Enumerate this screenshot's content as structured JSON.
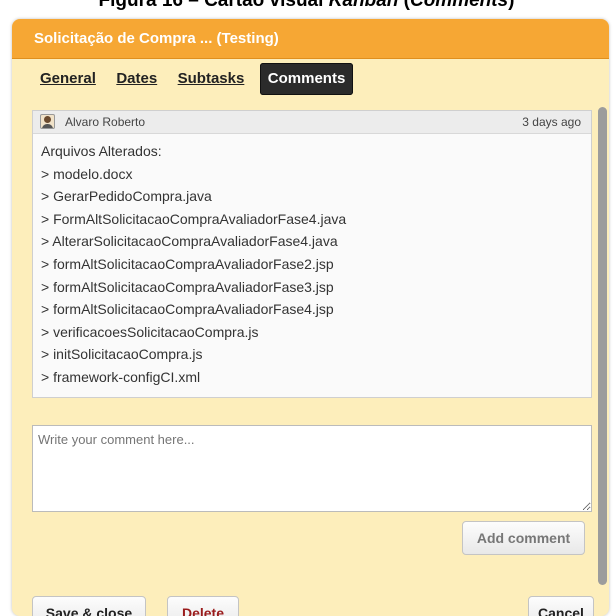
{
  "caption": {
    "prefix": "Figura 16 – Cartão visual ",
    "italic": "Kanban",
    "suffix_open": " (",
    "suffix_italic": "Comments",
    "suffix_close": ")"
  },
  "card": {
    "title": "Solicitação de Compra ... (Testing)",
    "tabs": [
      {
        "label": "General",
        "active": false
      },
      {
        "label": "Dates",
        "active": false
      },
      {
        "label": "Subtasks",
        "active": false
      },
      {
        "label": "Comments",
        "active": true
      }
    ]
  },
  "comment": {
    "author": "Alvaro Roberto",
    "time": "3 days ago",
    "avatar_icon": "user-avatar-icon",
    "lines": [
      "Arquivos Alterados:",
      "> modelo.docx",
      "> GerarPedidoCompra.java",
      "> FormAltSolicitacaoCompraAvaliadorFase4.java",
      "> AlterarSolicitacaoCompraAvaliadorFase4.java",
      "> formAltSolicitacaoCompraAvaliadorFase2.jsp",
      "> formAltSolicitacaoCompraAvaliadorFase3.jsp",
      "> formAltSolicitacaoCompraAvaliadorFase4.jsp",
      "> verificacoesSolicitacaoCompra.js",
      "> initSolicitacaoCompra.js",
      "> framework-configCI.xml"
    ]
  },
  "new_comment": {
    "placeholder": "Write your comment here...",
    "value": ""
  },
  "buttons": {
    "add_comment": "Add comment",
    "save_close": "Save & close",
    "delete": "Delete",
    "cancel": "Cancel"
  },
  "colors": {
    "title_bar": "#f6a734",
    "card_background": "#fdeebb",
    "active_tab": "#2b2b2b",
    "delete_text": "#9a1b1b"
  }
}
